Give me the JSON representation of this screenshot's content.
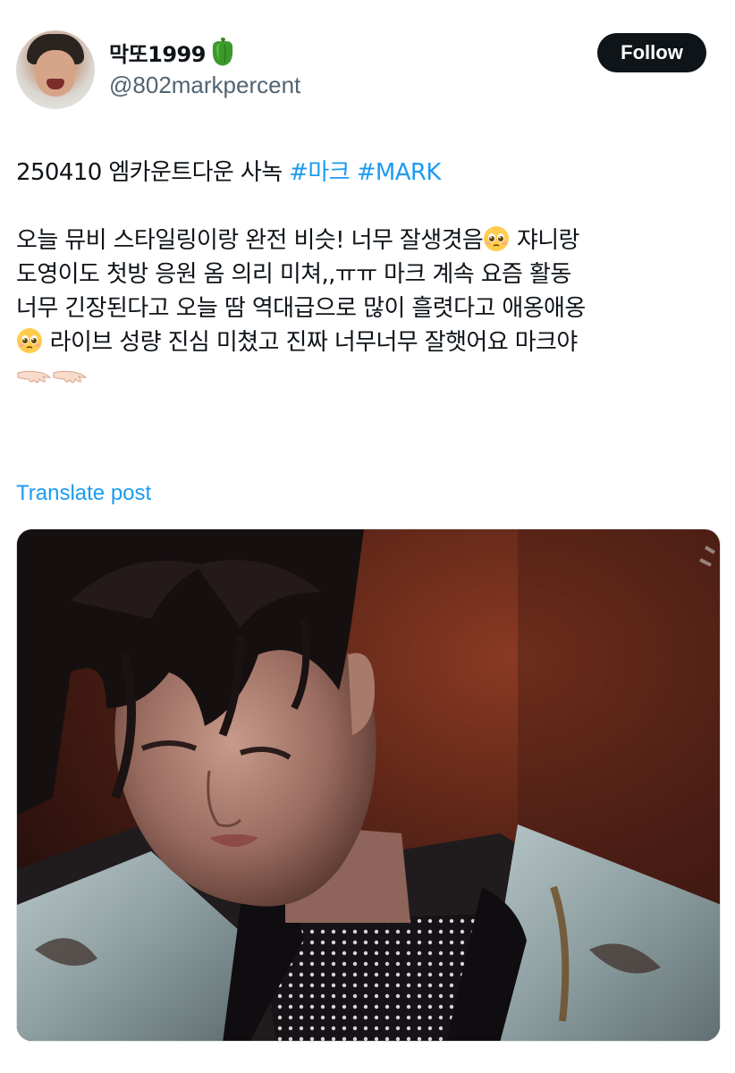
{
  "author": {
    "display_name": "막또1999",
    "name_emoji": "green-bell-pepper-icon",
    "handle": "@802markpercent",
    "avatar": "user-avatar"
  },
  "follow_button": {
    "label": "Follow"
  },
  "post": {
    "line1_text": "250410 엠카운트다운 사녹 ",
    "hashtags": [
      "#마크",
      "#MARK"
    ],
    "line2_text": "오늘 뮤비 스타일링이랑 완전 비슷! 너무 잘생겻음",
    "line2_tail": " 쟈니랑",
    "line3_text": "도영이도 첫방 응원 옴 의리 미쳐,,ㅠㅠ 마크 계속 요즘 활동",
    "line4_text": "너무 긴장된다고 오늘 땀 역대급으로 많이 흘렷다고 애옹애옹",
    "line5_text": " 라이브 성량 진심 미쳤고 진짜 너무너무 잘햇어요 마크야",
    "emojis": [
      "pleading-face-icon",
      "palm-down-hand-icon"
    ]
  },
  "translate_link": {
    "label": "Translate post"
  },
  "media": {
    "type": "photo"
  },
  "colors": {
    "accent": "#1d9bf0",
    "text": "#0f1419",
    "secondary_text": "#536471",
    "follow_bg": "#0f1419"
  }
}
